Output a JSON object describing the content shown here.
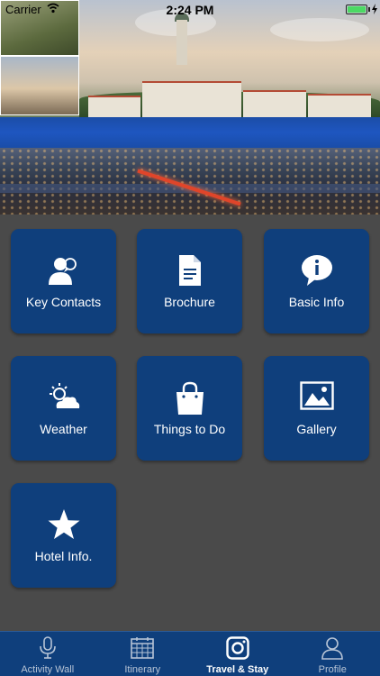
{
  "status_bar": {
    "carrier": "Carrier",
    "time": "2:24 PM",
    "battery_level": 1.0,
    "battery_color": "#4cd964"
  },
  "header": {
    "image_description_icon": "city-collage-image"
  },
  "tiles": [
    {
      "label": "Key Contacts",
      "icon": "contact-support-icon"
    },
    {
      "label": "Brochure",
      "icon": "document-icon"
    },
    {
      "label": "Basic Info",
      "icon": "info-bubble-icon"
    },
    {
      "label": "Weather",
      "icon": "weather-icon"
    },
    {
      "label": "Things to Do",
      "icon": "shopping-bag-icon"
    },
    {
      "label": "Gallery",
      "icon": "gallery-icon"
    },
    {
      "label": "Hotel Info.",
      "icon": "star-icon"
    }
  ],
  "tabbar": {
    "tabs": [
      {
        "label": "Activity Wall",
        "icon": "microphone-icon",
        "active": false
      },
      {
        "label": "Itinerary",
        "icon": "calendar-icon",
        "active": false
      },
      {
        "label": "Travel & Stay",
        "icon": "camera-icon",
        "active": true
      },
      {
        "label": "Profile",
        "icon": "person-icon",
        "active": false
      }
    ]
  },
  "colors": {
    "tile_bg": "#0f3f7c",
    "page_bg": "#4a4a4a",
    "tabbar_bg": "#0f3f7c",
    "header_band": "#1e56c0"
  }
}
